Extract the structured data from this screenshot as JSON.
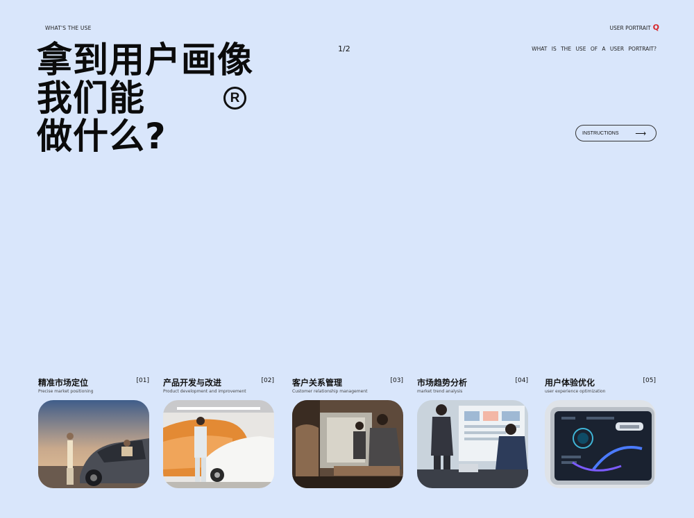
{
  "header": {
    "left_label": "WHAT'S THE USE",
    "right_label": "USER PORTRAIT",
    "right_icon": "Q",
    "page_number": "1/2",
    "subtitle": "WHAT IS THE USE OF A USER PORTRAIT?"
  },
  "title": {
    "line1": "拿到用户画像",
    "line2": "我们能",
    "line3": "做什么?",
    "registered_mark": "R"
  },
  "instructions_button": {
    "label": "INSTRUCTIONS",
    "arrow": "⟶"
  },
  "cards": [
    {
      "title": "精准市场定位",
      "subtitle": "Precise market positioning",
      "number": "[01]"
    },
    {
      "title": "产品开发与改进",
      "subtitle": "Product development and improvement",
      "number": "[02]"
    },
    {
      "title": "客户关系管理",
      "subtitle": "Customer relationship management",
      "number": "[03]"
    },
    {
      "title": "市场趋势分析",
      "subtitle": "market trend analysis",
      "number": "[04]"
    },
    {
      "title": "用户体验优化",
      "subtitle": "user experience optimization",
      "number": "[05]"
    }
  ]
}
